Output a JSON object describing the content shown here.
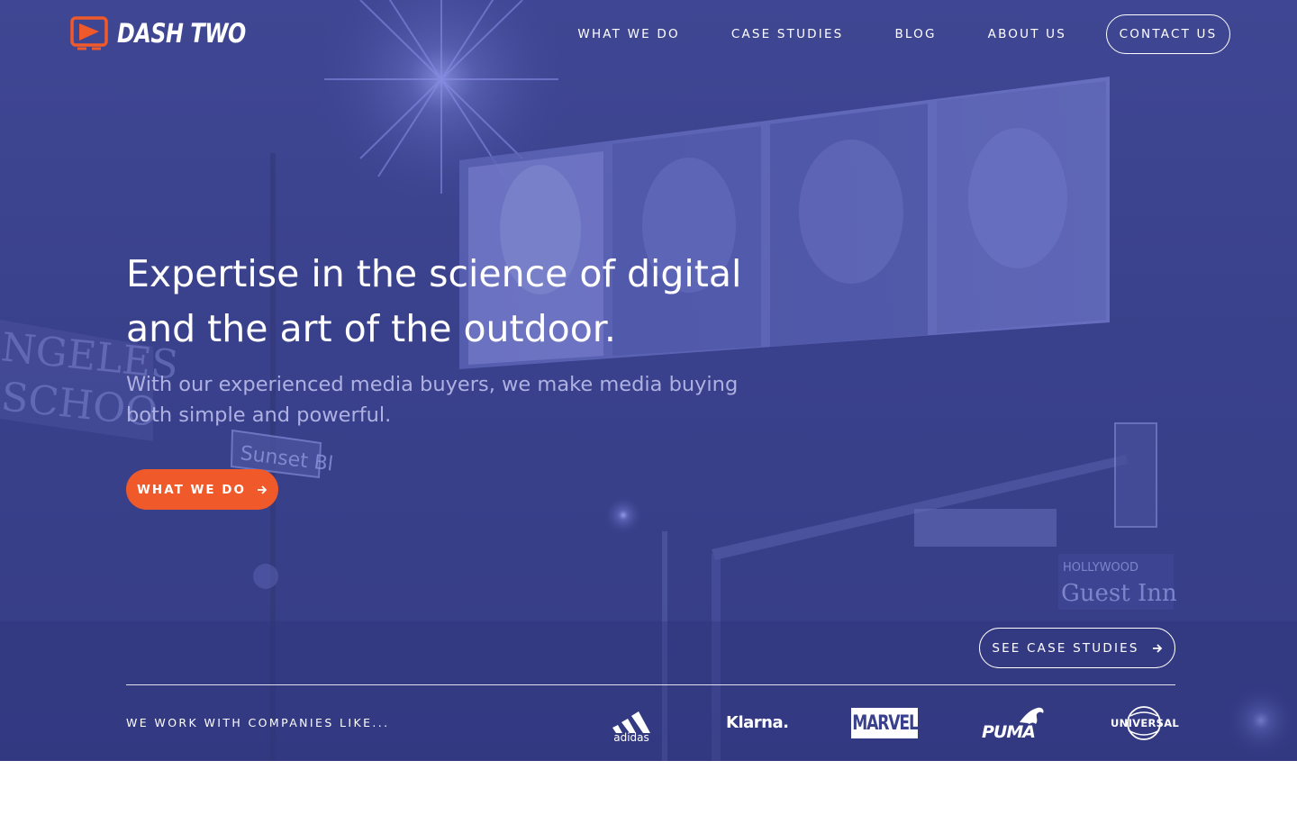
{
  "colors": {
    "hero_overlay": "#3a418c",
    "accent": "#f0592a",
    "subtext": "#aeb1e2"
  },
  "header": {
    "logo_text": "DASH TWO",
    "logo_icon": "play-screen-icon",
    "nav": [
      {
        "label": "WHAT WE DO"
      },
      {
        "label": "CASE STUDIES"
      },
      {
        "label": "BLOG"
      },
      {
        "label": "ABOUT US"
      }
    ],
    "contact_label": "CONTACT US"
  },
  "hero": {
    "headline": "Expertise in the science of digital and the art of the outdoor.",
    "subheadline": "With our experienced media buyers, we make media buying both simple and powerful.",
    "cta_label": "WHAT WE DO",
    "cta_icon": "arrow-right-icon",
    "see_cases_label": "SEE CASE STUDIES",
    "see_cases_icon": "arrow-right-icon",
    "background_billboard_text": "Sunset Bl",
    "background_hotel_text": "HOLLYWOOD Guest Inn"
  },
  "clients": {
    "label": "WE WORK WITH COMPANIES LIKE...",
    "logos": [
      "adidas",
      "Klarna.",
      "MARVEL",
      "PUMA",
      "UNIVERSAL"
    ]
  }
}
